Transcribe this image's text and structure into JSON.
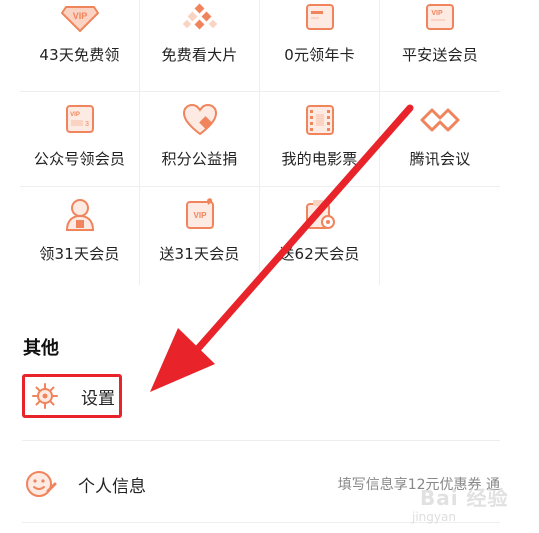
{
  "benefits": [
    {
      "label": "43天免费领",
      "icon": "vip-badge-icon"
    },
    {
      "label": "免费看大片",
      "icon": "checker-dots-icon"
    },
    {
      "label": "0元领年卡",
      "icon": "card-icon"
    },
    {
      "label": "平安送会员",
      "icon": "vip-card-icon"
    },
    {
      "label": "公众号领会员",
      "icon": "vip-ticket-icon"
    },
    {
      "label": "积分公益捐",
      "icon": "heart-icon"
    },
    {
      "label": "我的电影票",
      "icon": "film-ticket-icon"
    },
    {
      "label": "腾讯会议",
      "icon": "meeting-logo-icon"
    },
    {
      "label": "领31天会员",
      "icon": "gift-person-icon"
    },
    {
      "label": "送31天会员",
      "icon": "vip-gift-card-icon"
    },
    {
      "label": "送62天会员",
      "icon": "gift-coin-icon"
    }
  ],
  "other": {
    "title": "其他",
    "settings_label": "设置",
    "profile_label": "个人信息",
    "profile_hint": "填写信息享12元优惠券 通"
  },
  "watermark": {
    "text": "Bai 经验",
    "sub": "jingyan"
  },
  "colors": {
    "icon_accent": "#f0845c",
    "icon_light": "#fbd3c2",
    "highlight": "#e8232a"
  }
}
